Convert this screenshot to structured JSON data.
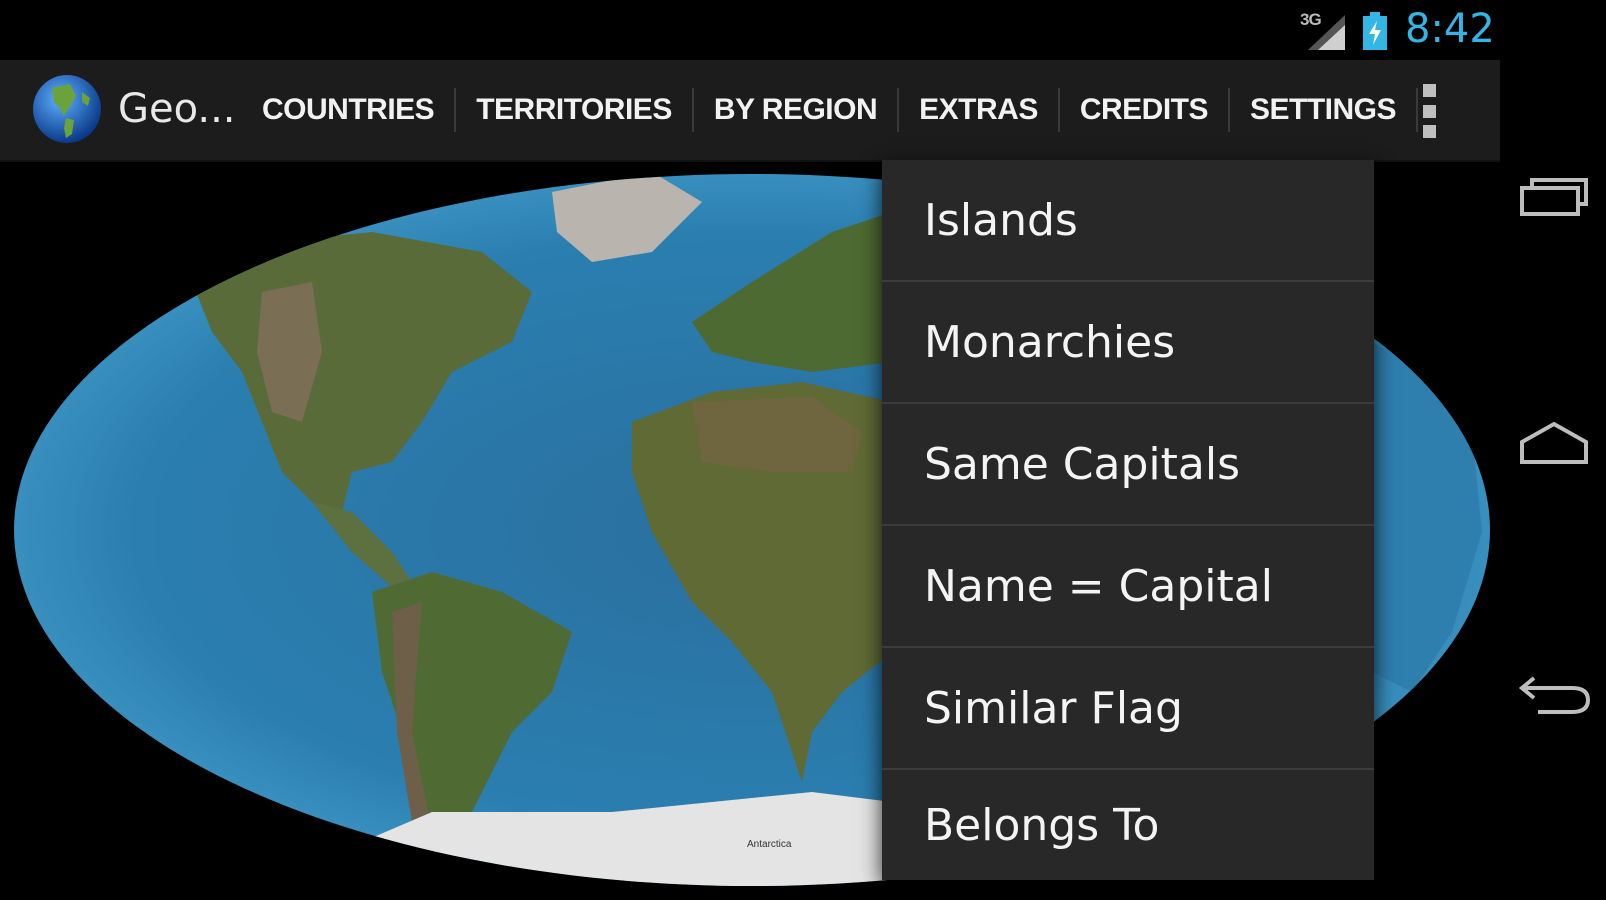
{
  "status_bar": {
    "network": "3G",
    "time": "8:42"
  },
  "action_bar": {
    "title": "Geo...",
    "tabs": [
      "COUNTRIES",
      "TERRITORIES",
      "BY REGION",
      "EXTRAS",
      "CREDITS",
      "SETTINGS"
    ]
  },
  "menu": {
    "items": [
      "Islands",
      "Monarchies",
      "Same Capitals",
      "Name = Capital",
      "Similar Flag",
      "Belongs To"
    ]
  },
  "map": {
    "label": "Antarctica"
  },
  "colors": {
    "accent": "#33b5e5",
    "action_bar": "#1c1c1c",
    "menu_bg": "#282828"
  },
  "icons": [
    "globe-icon",
    "signal-icon",
    "battery-icon",
    "overflow-menu-icon",
    "recent-apps-icon",
    "home-icon",
    "back-icon"
  ]
}
